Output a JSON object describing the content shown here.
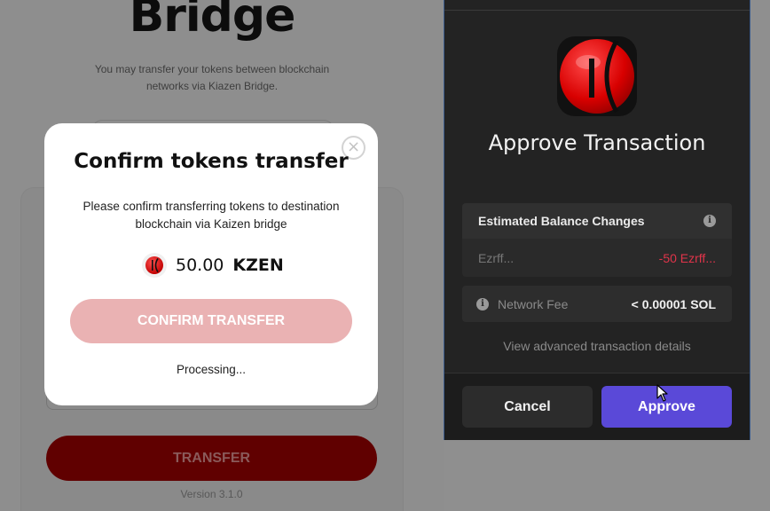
{
  "background_page": {
    "title": "Bridge",
    "subtitle": "You may transfer your tokens between blockchain networks via Kiazen Bridge.",
    "transfer_label": "TRANSFER",
    "version": "Version 3.1.0"
  },
  "modal": {
    "close_glyph": "×",
    "title": "Confirm tokens transfer",
    "description": "Please confirm transferring tokens to destination blockchain via Kaizen bridge",
    "amount": "50.00",
    "symbol": "KZEN",
    "token_icon": "kaizen-logo-icon",
    "confirm_label": "CONFIRM TRANSFER",
    "status": "Processing..."
  },
  "wallet": {
    "title": "Approve Transaction",
    "logo_icon": "kaizen-logo-icon",
    "balance_changes_label": "Estimated Balance Changes",
    "balance_token": "Ezrff...",
    "balance_delta": "-50 Ezrff...",
    "fee_label": "Network Fee",
    "fee_value": "< 0.00001 SOL",
    "advanced_link": "View advanced transaction details",
    "cancel_label": "Cancel",
    "approve_label": "Approve",
    "info_glyph": "i"
  },
  "colors": {
    "accent_purple": "#5a49d8",
    "confirm_pink": "#eab2b3",
    "negative_red": "#e0344a",
    "brand_red": "#e01010"
  }
}
